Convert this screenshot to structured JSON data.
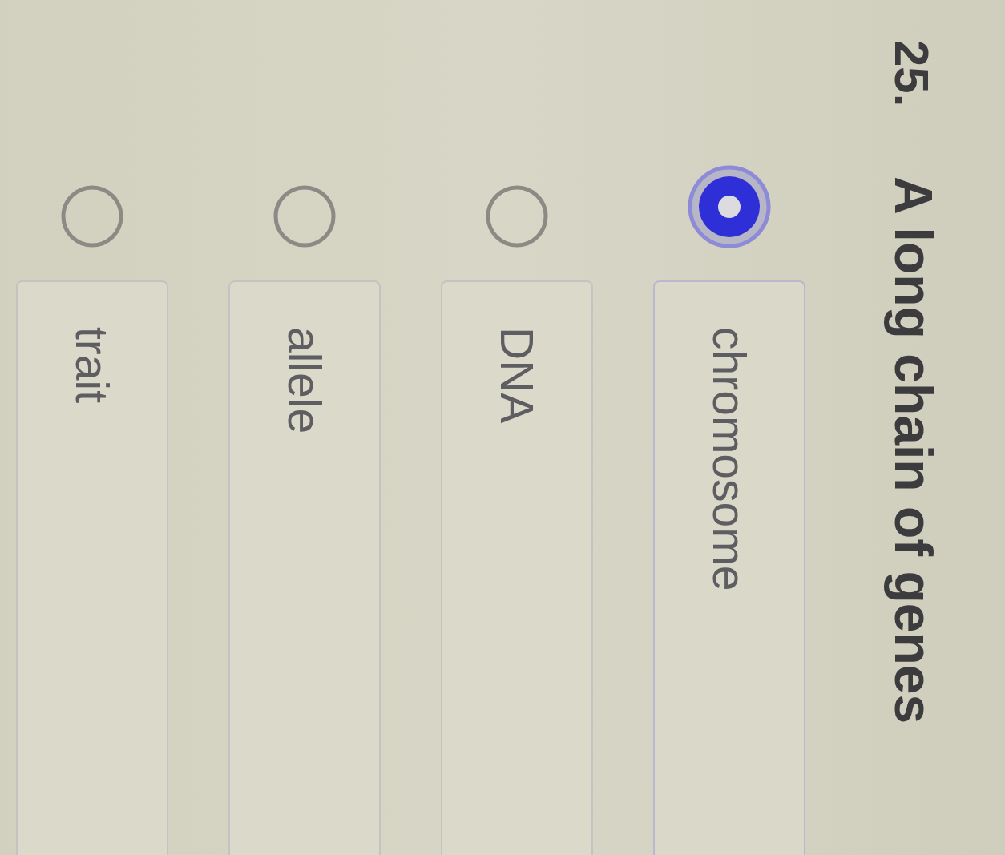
{
  "question": {
    "number": "25.",
    "text": "A long chain of genes"
  },
  "options": [
    {
      "label": "chromosome",
      "selected": true
    },
    {
      "label": "DNA",
      "selected": false
    },
    {
      "label": "allele",
      "selected": false
    },
    {
      "label": "trait",
      "selected": false
    }
  ]
}
